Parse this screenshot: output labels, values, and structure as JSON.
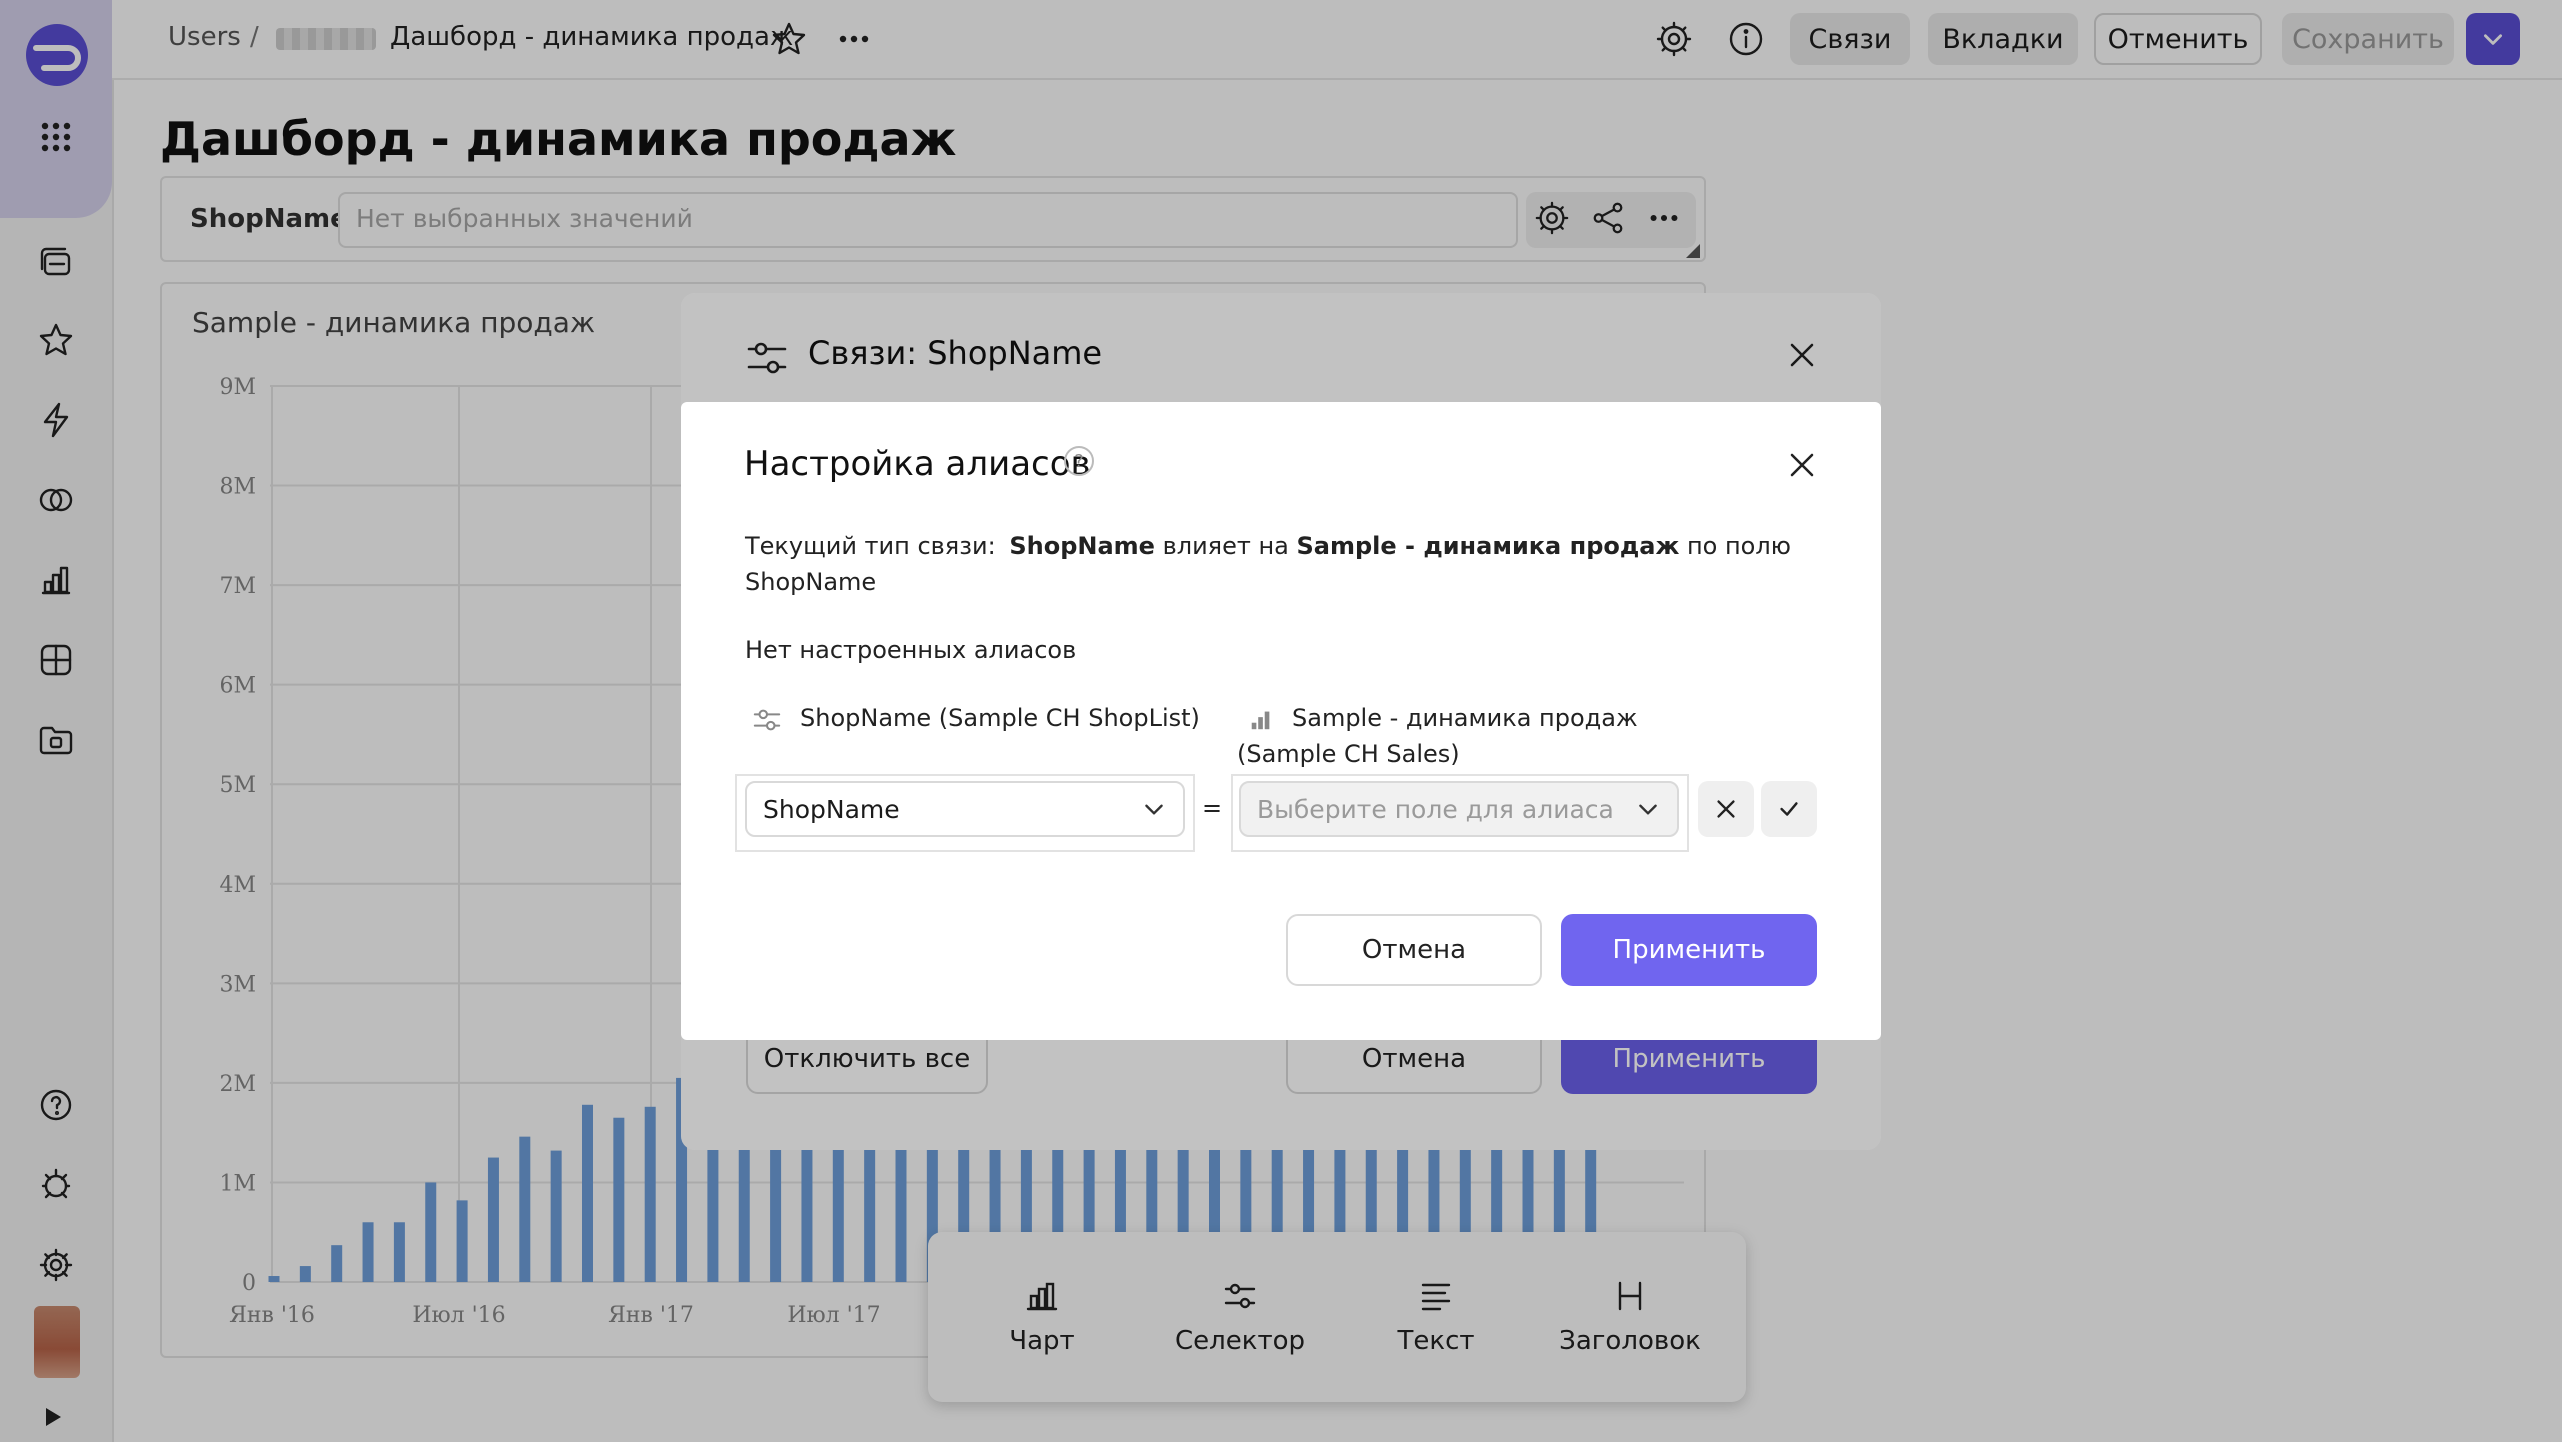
{
  "header": {
    "breadcrumb_root": "Users",
    "breadcrumb_sep": "/",
    "dashboard_name": "Дашборд - динамика продаж",
    "btn_links": "Связи",
    "btn_tabs": "Вкладки",
    "btn_cancel": "Отменить",
    "btn_save": "Сохранить"
  },
  "page": {
    "title": "Дашборд - динамика продаж"
  },
  "selector_widget": {
    "label": "ShopName",
    "placeholder": "Нет выбранных значений"
  },
  "chart_widget": {
    "title": "Sample - динамика продаж"
  },
  "chart_data": {
    "type": "bar",
    "title": "Sample - динамика продаж",
    "y_ticks": [
      "9M",
      "8M",
      "7M",
      "6M",
      "5M",
      "4M",
      "3M",
      "2M",
      "1M",
      "0"
    ],
    "ylim": [
      0,
      9000000
    ],
    "x_tick_labels": [
      "Янв '16",
      "Июл '16",
      "Янв '17",
      "Июл '17"
    ],
    "grid": true,
    "values": [
      0.06,
      0.16,
      0.37,
      0.6,
      0.6,
      1.0,
      0.82,
      1.25,
      1.46,
      1.32,
      1.78,
      1.65,
      1.76,
      2.05,
      1.95,
      1.95,
      1.95,
      1.95,
      1.95,
      1.95,
      1.95,
      1.95,
      1.95,
      1.95,
      1.95,
      1.95,
      1.95,
      1.95,
      1.95,
      1.95,
      1.95,
      1.95,
      1.95,
      1.95,
      1.95,
      1.95,
      1.95,
      1.95,
      1.95,
      1.95,
      1.95,
      1.95,
      1.95
    ],
    "values_unit": "M",
    "bar_color": "#6fa0dc"
  },
  "add_bar": {
    "chart": "Чарт",
    "selector": "Селектор",
    "text": "Текст",
    "heading": "Заголовок"
  },
  "links_dialog": {
    "title": "Связи: ShopName",
    "btn_disable_all": "Отключить все",
    "btn_cancel": "Отмена",
    "btn_apply": "Применить"
  },
  "alias_dialog": {
    "title": "Настройка алиасов",
    "help": "?",
    "current_prefix": "Текущий тип связи:",
    "current_source": "ShopName",
    "current_verb": "влияет на",
    "current_target": "Sample - динамика продаж",
    "current_suffix": "по полю",
    "current_field": "ShopName",
    "no_aliases": "Нет настроенных алиасов",
    "col_left": "ShopName (Sample CH ShopList)",
    "col_right_line1": "Sample - динамика продаж",
    "col_right_line2": "(Sample CH Sales)",
    "left_value": "ShopName",
    "equals": "=",
    "right_placeholder": "Выберите поле для алиаса",
    "btn_cancel": "Отмена",
    "btn_apply": "Применить"
  },
  "colors": {
    "accent": "#6a5fe8",
    "header_accent": "#5b4fd6"
  }
}
